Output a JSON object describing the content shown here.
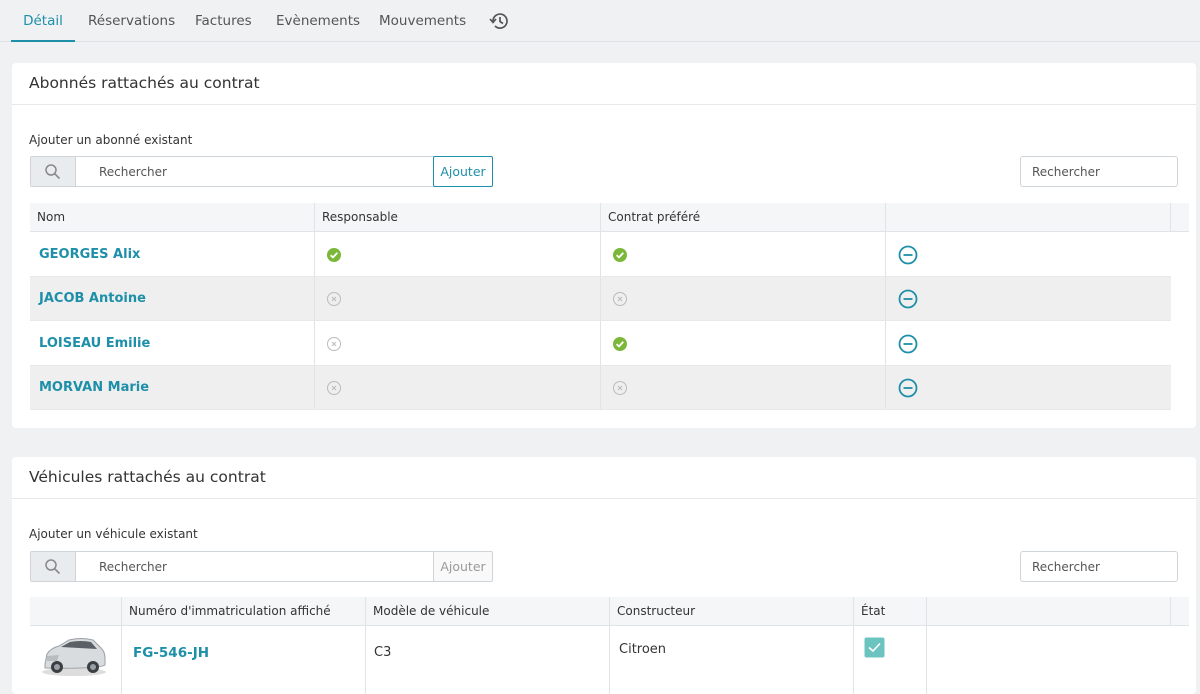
{
  "tabs": [
    {
      "label": "Détail",
      "active": true
    },
    {
      "label": "Réservations"
    },
    {
      "label": "Factures"
    },
    {
      "label": "Evènements"
    },
    {
      "label": "Mouvements"
    }
  ],
  "subscribers": {
    "title": "Abonnés rattachés au contrat",
    "add_label": "Ajouter un abonné existant",
    "search_placeholder": "Rechercher",
    "add_button": "Ajouter",
    "filter_placeholder": "Rechercher",
    "columns": [
      "Nom",
      "Responsable",
      "Contrat préféré",
      ""
    ],
    "rows": [
      {
        "name": "GEORGES Alix",
        "responsable": true,
        "prefere": true
      },
      {
        "name": "JACOB Antoine",
        "responsable": false,
        "prefere": false
      },
      {
        "name": "LOISEAU Emilie",
        "responsable": false,
        "prefere": true
      },
      {
        "name": "MORVAN Marie",
        "responsable": false,
        "prefere": false
      }
    ]
  },
  "vehicles": {
    "title": "Véhicules rattachés au contrat",
    "add_label": "Ajouter un véhicule existant",
    "search_placeholder": "Rechercher",
    "add_button": "Ajouter",
    "filter_placeholder": "Rechercher",
    "columns": [
      "",
      "Numéro d'immatriculation affiché",
      "Modèle de véhicule",
      "Constructeur",
      "État",
      ""
    ],
    "rows": [
      {
        "plate": "FG-546-JH",
        "model": "C3",
        "maker": "Citroen",
        "state_ok": true
      }
    ]
  },
  "colors": {
    "accent": "#1e8fa8",
    "check_green": "#7bb83a",
    "state_teal": "#6cc4c0"
  }
}
